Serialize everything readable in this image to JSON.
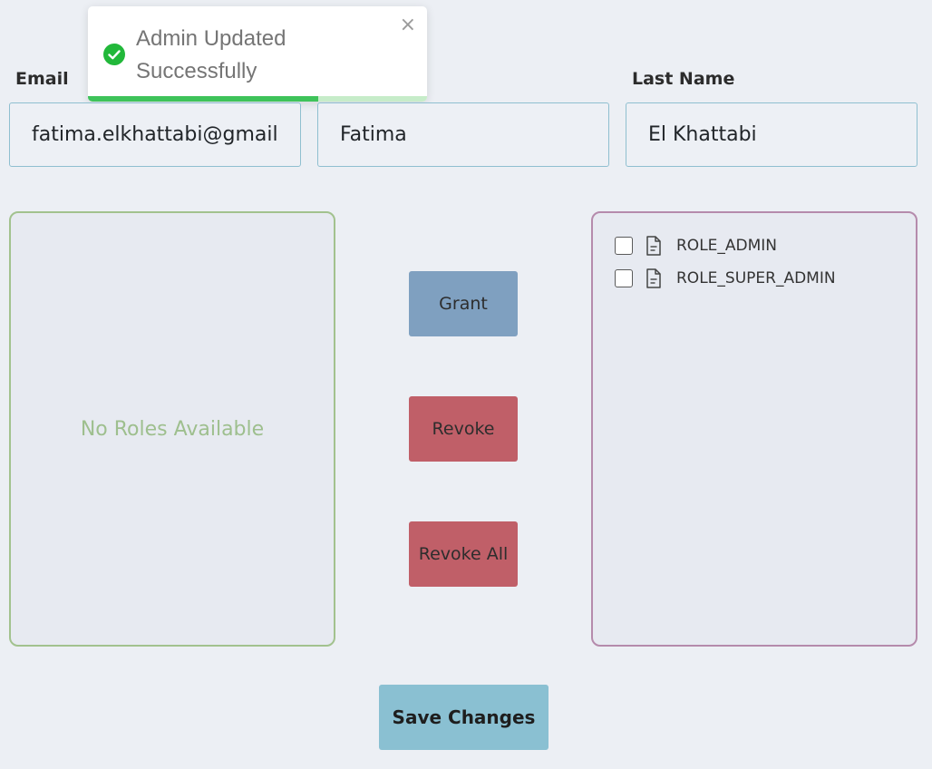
{
  "form": {
    "email": {
      "label": "Email",
      "value": "fatima.elkhattabi@gmail.com"
    },
    "first_name": {
      "value": "Fatima"
    },
    "last_name": {
      "label": "Last Name",
      "value": "El Khattabi"
    }
  },
  "roles": {
    "available": {
      "empty_text": "No Roles Available",
      "items": []
    },
    "assigned": {
      "items": [
        {
          "label": "ROLE_ADMIN",
          "checked": false,
          "icon": "file-icon"
        },
        {
          "label": "ROLE_SUPER_ADMIN",
          "checked": false,
          "icon": "file-icon"
        }
      ]
    }
  },
  "actions": {
    "grant_label": "Grant",
    "revoke_label": "Revoke",
    "revoke_all_label": "Revoke All",
    "save_label": "Save Changes"
  },
  "toast": {
    "message": "Admin Updated Successfully",
    "close_symbol": "×",
    "icon": "check-circle-icon",
    "progress": 0.68
  },
  "colors": {
    "success": "#3ec35a",
    "grant": "#7fa0c0",
    "revoke": "#c05f68",
    "save": "#8ac0d2"
  }
}
